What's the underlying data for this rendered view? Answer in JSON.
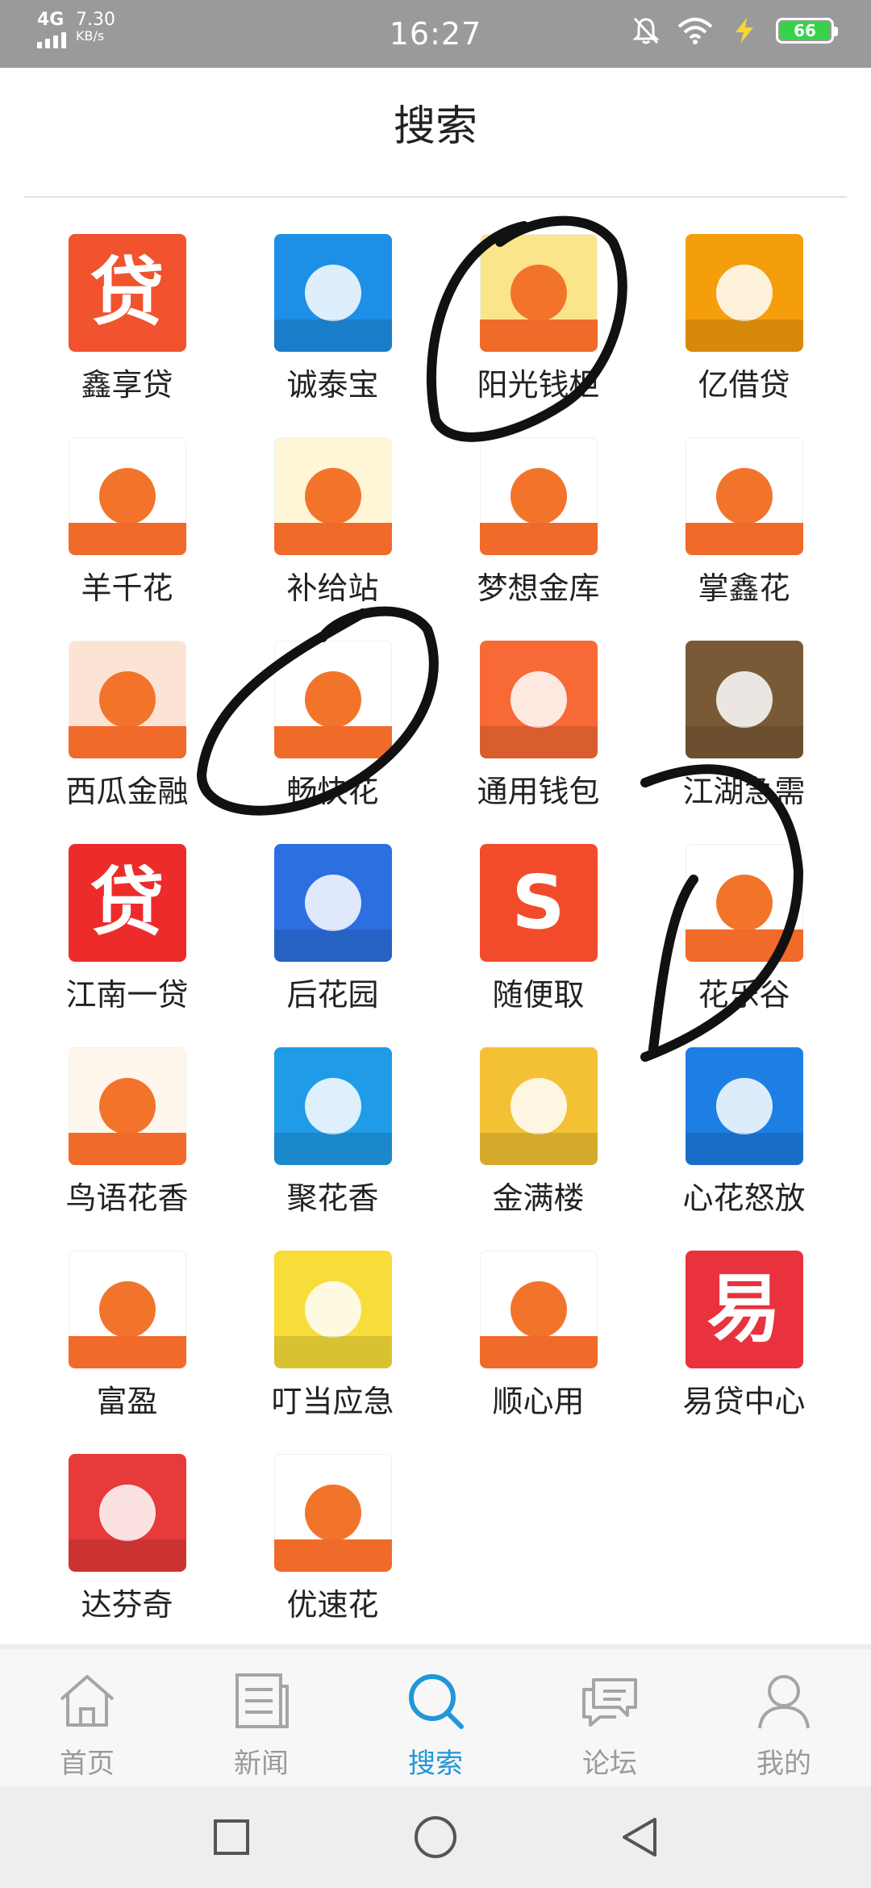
{
  "status_bar": {
    "network": "4G",
    "speed": "7.30",
    "speed_unit": "KB/s",
    "time": "16:27",
    "battery": "66",
    "battery_color": "#37d24a"
  },
  "header": {
    "title": "搜索"
  },
  "apps": [
    {
      "label": "鑫享贷",
      "glyph": "贷",
      "color": "#f0532e",
      "icon": "loan-char-icon"
    },
    {
      "label": "诚泰宝",
      "glyph": "",
      "color": "#1e8fe6",
      "icon": "gold-ingot-icon"
    },
    {
      "label": "阳光钱柜",
      "glyph": "",
      "color": "#fbe58a",
      "icon": "money-bag-icon"
    },
    {
      "label": "亿借贷",
      "glyph": "",
      "color": "#f59e0b",
      "icon": "coin-ring-icon"
    },
    {
      "label": "羊千花",
      "glyph": "",
      "color": "#ffffff",
      "icon": "sheep-icon"
    },
    {
      "label": "补给站",
      "glyph": "",
      "color": "#fff6d8",
      "icon": "fuel-station-icon"
    },
    {
      "label": "梦想金库",
      "glyph": "",
      "color": "#ffffff",
      "icon": "winged-coin-icon"
    },
    {
      "label": "掌鑫花",
      "glyph": "",
      "color": "#ffffff",
      "icon": "flame-coin-icon"
    },
    {
      "label": "西瓜金融",
      "glyph": "",
      "color": "#fde3d3",
      "icon": "watermelon-icon"
    },
    {
      "label": "畅快花",
      "glyph": "",
      "color": "#ffffff",
      "icon": "orange-flower-icon"
    },
    {
      "label": "通用钱包",
      "glyph": "",
      "color": "#f76a35",
      "icon": "wallet-text-icon"
    },
    {
      "label": "江湖急需",
      "glyph": "",
      "color": "#7a5a36",
      "icon": "swordsman-icon"
    },
    {
      "label": "江南一贷",
      "glyph": "贷",
      "color": "#ee2b2b",
      "icon": "loan-char-icon"
    },
    {
      "label": "后花园",
      "glyph": "",
      "color": "#2c6fe0",
      "icon": "cloud-flower-icon"
    },
    {
      "label": "随便取",
      "glyph": "S",
      "color": "#f24b2b",
      "icon": "s-badge-icon"
    },
    {
      "label": "花乐谷",
      "glyph": "",
      "color": "#ffffff",
      "icon": "red-flower-icon"
    },
    {
      "label": "鸟语花香",
      "glyph": "",
      "color": "#fff6ee",
      "icon": "phoenix-icon"
    },
    {
      "label": "聚花香",
      "glyph": "",
      "color": "#1f9be8",
      "icon": "swirl-icon"
    },
    {
      "label": "金满楼",
      "glyph": "",
      "color": "#f3c133",
      "icon": "pavilion-icon"
    },
    {
      "label": "心花怒放",
      "glyph": "",
      "color": "#1d7fe3",
      "icon": "cross-petal-icon"
    },
    {
      "label": "富盈",
      "glyph": "",
      "color": "#ffffff",
      "icon": "swirl-ring-icon"
    },
    {
      "label": "叮当应急",
      "glyph": "",
      "color": "#f8dd3a",
      "icon": "hero-icon"
    },
    {
      "label": "顺心用",
      "glyph": "",
      "color": "#ffffff",
      "icon": "heart-coin-icon"
    },
    {
      "label": "易贷中心",
      "glyph": "易",
      "color": "#e9323d",
      "icon": "loan-center-icon"
    },
    {
      "label": "达芬奇",
      "glyph": "",
      "color": "#e73a3a",
      "icon": "knot-icon"
    },
    {
      "label": "优速花",
      "glyph": "",
      "color": "#ffffff",
      "icon": "clover-icon"
    }
  ],
  "bottom_nav": {
    "tabs": [
      {
        "label": "首页",
        "icon": "home-icon"
      },
      {
        "label": "新闻",
        "icon": "news-icon"
      },
      {
        "label": "搜索",
        "icon": "search-icon"
      },
      {
        "label": "论坛",
        "icon": "forum-icon"
      },
      {
        "label": "我的",
        "icon": "profile-icon"
      }
    ],
    "active_color": "#2196d8",
    "inactive_color": "#9a9a9a"
  }
}
